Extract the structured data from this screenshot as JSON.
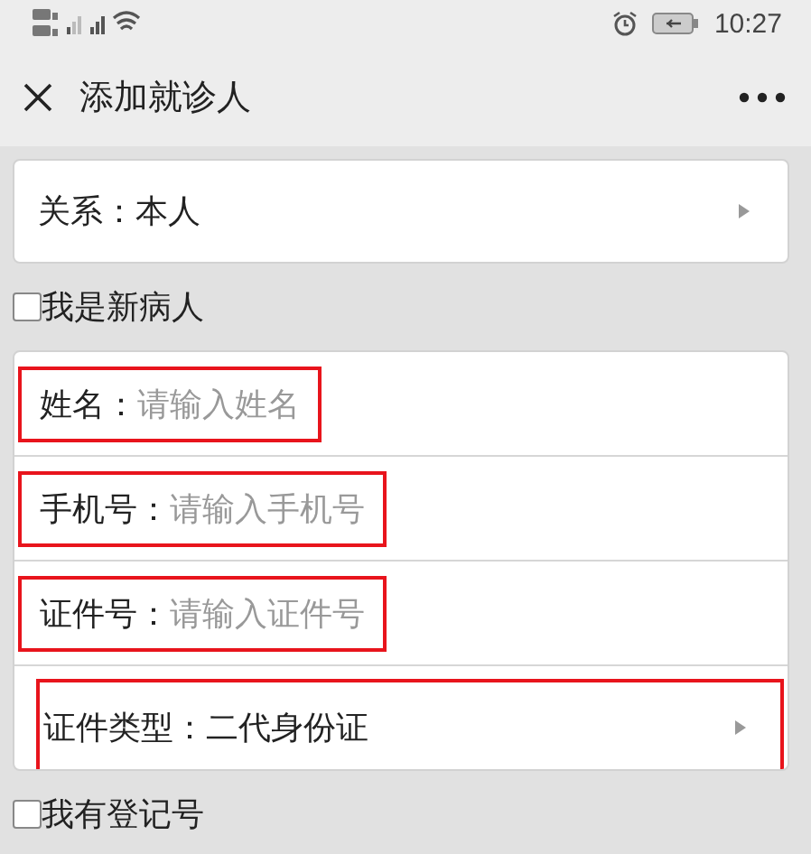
{
  "status_bar": {
    "time": "10:27"
  },
  "header": {
    "title": "添加就诊人"
  },
  "relation": {
    "label": "关系：",
    "value": "本人"
  },
  "new_patient": {
    "label": "我是新病人",
    "checked": false
  },
  "fields": [
    {
      "kind": "input",
      "label": "姓名：",
      "placeholder": "请输入姓名",
      "highlighted": true
    },
    {
      "kind": "input",
      "label": "手机号：",
      "placeholder": "请输入手机号",
      "highlighted": true
    },
    {
      "kind": "input",
      "label": "证件号：",
      "placeholder": "请输入证件号",
      "highlighted": true
    },
    {
      "kind": "select",
      "label": "证件类型：",
      "value": "二代身份证",
      "highlighted": true
    }
  ],
  "registered": {
    "label": "我有登记号",
    "checked": false
  }
}
